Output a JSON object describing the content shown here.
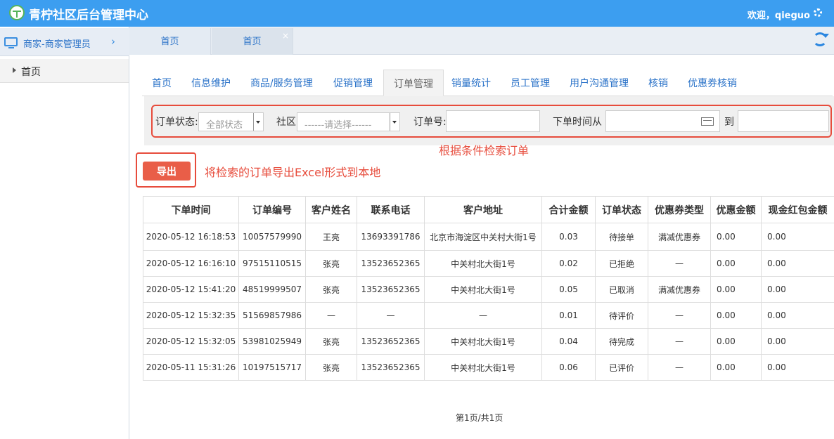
{
  "header": {
    "title": "青柠社区后台管理中心",
    "welcome": "欢迎，qieguo"
  },
  "sidebar": {
    "role": "商家-商家管理员",
    "items": [
      {
        "label": "首页"
      }
    ]
  },
  "page_tabs": [
    {
      "label": "首页"
    },
    {
      "label": "首页",
      "close": "×"
    }
  ],
  "nav_tabs": [
    {
      "label": "首页"
    },
    {
      "label": "信息维护"
    },
    {
      "label": "商品/服务管理"
    },
    {
      "label": "促销管理"
    },
    {
      "label": "订单管理",
      "active": true
    },
    {
      "label": "销量统计"
    },
    {
      "label": "员工管理"
    },
    {
      "label": "用户沟通管理"
    },
    {
      "label": "核销"
    },
    {
      "label": "优惠券核销"
    }
  ],
  "filter": {
    "status_label": "订单状态:",
    "status_value": "全部状态",
    "community_label": "社区",
    "community_value": "------请选择------",
    "order_no_label": "订单号:",
    "time_from_label": "下单时间从",
    "time_to_label": "到",
    "hint": "根据条件检索订单"
  },
  "export": {
    "label": "导出",
    "hint": "将检索的订单导出Excel形式到本地"
  },
  "table": {
    "headers": [
      "下单时间",
      "订单编号",
      "客户姓名",
      "联系电话",
      "客户地址",
      "合计金额",
      "订单状态",
      "优惠券类型",
      "优惠金额",
      "现金红包金额"
    ],
    "rows": [
      [
        "2020-05-12 16:18:53",
        "10057579990",
        "王亮",
        "13693391786",
        "北京市海淀区中关村大街1号",
        "0.03",
        "待接单",
        "满减优惠券",
        "0.00",
        "0.00"
      ],
      [
        "2020-05-12 16:16:10",
        "97515110515",
        "张亮",
        "13523652365",
        "中关村北大街1号",
        "0.02",
        "已拒绝",
        "—",
        "0.00",
        "0.00"
      ],
      [
        "2020-05-12 15:41:20",
        "48519999507",
        "张亮",
        "13523652365",
        "中关村北大街1号",
        "0.05",
        "已取消",
        "满减优惠券",
        "0.00",
        "0.00"
      ],
      [
        "2020-05-12 15:32:35",
        "51569857986",
        "—",
        "—",
        "—",
        "0.01",
        "待评价",
        "—",
        "0.00",
        "0.00"
      ],
      [
        "2020-05-12 15:32:05",
        "53981025949",
        "张亮",
        "13523652365",
        "中关村北大街1号",
        "0.04",
        "待完成",
        "—",
        "0.00",
        "0.00"
      ],
      [
        "2020-05-11 15:31:26",
        "10197515717",
        "张亮",
        "13523652365",
        "中关村北大街1号",
        "0.06",
        "已评价",
        "—",
        "0.00",
        "0.00"
      ]
    ]
  },
  "pager": "第1页/共1页",
  "colors": {
    "header": "#3c9ef0",
    "accent": "#e74c3c",
    "link": "#2a72c8"
  }
}
